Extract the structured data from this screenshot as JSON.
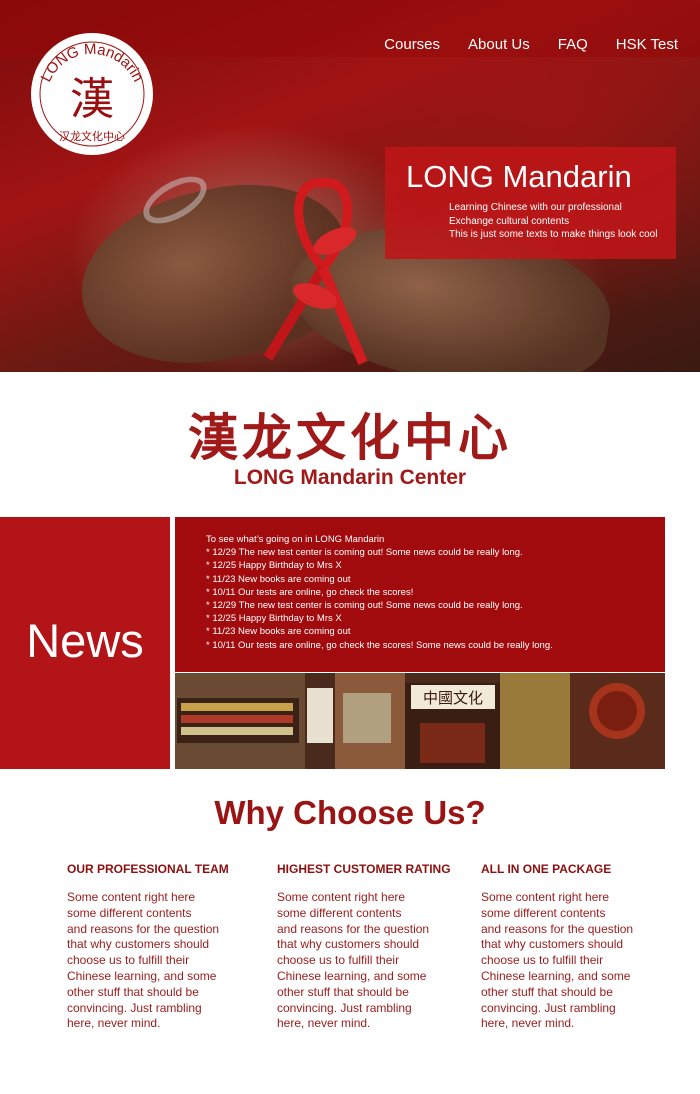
{
  "nav": {
    "items": [
      "Courses",
      "About Us",
      "FAQ",
      "HSK Test"
    ]
  },
  "logo": {
    "text": "LONG Mandarin",
    "chars": "汉龙文化中心",
    "glyph": "漢"
  },
  "hero": {
    "title": "LONG Mandarin",
    "lines": [
      "Learning Chinese with our professional",
      "Exchange cultural contents",
      "This is just some texts to make things look cool"
    ]
  },
  "headings": {
    "chinese": "漢龙文化中心",
    "english": "LONG Mandarin Center"
  },
  "news": {
    "label": "News",
    "items": [
      "To see what’s going on in LONG Mandarin",
      "* 12/29 The new test center is coming out! Some news could be really long.",
      "* 12/25 Happy Birthday to Mrs X",
      "* 11/23 New books are coming out",
      "* 10/11 Our tests are online, go check the scores!",
      "* 12/29 The new test center is coming out! Some news could be really long.",
      "* 12/25 Happy Birthday to Mrs X",
      "* 11/23 New books are coming out",
      "* 10/11 Our tests are online, go check the scores! Some news could be really long."
    ],
    "photo_sign": "中國文化"
  },
  "why": {
    "title": "Why Choose Us?",
    "columns": [
      {
        "heading": "OUR PROFESSIONAL TEAM",
        "lines": [
          "Some content right here",
          "some different contents",
          "and reasons for the question",
          "that why customers should",
          "choose us to fulfill their",
          "Chinese learning, and some",
          "other stuff that should be",
          "convincing. Just rambling",
          "here, never mind."
        ]
      },
      {
        "heading": "HIGHEST CUSTOMER RATING",
        "lines": [
          "Some content right here",
          "some different contents",
          "and reasons for the question",
          "that why customers should",
          "choose us to fulfill their",
          "Chinese learning, and some",
          "other stuff that should be",
          "convincing. Just rambling",
          "here, never mind."
        ]
      },
      {
        "heading": "ALL IN ONE PACKAGE",
        "lines": [
          "Some content right here",
          "some different contents",
          "and reasons for the question",
          "that why customers should",
          "choose us to fulfill their",
          "Chinese learning, and some",
          "other stuff that should be",
          "convincing. Just rambling",
          "here, never mind."
        ]
      }
    ]
  },
  "colors": {
    "brand_red": "#a20b0e",
    "text_red": "#8c1010",
    "white": "#ffffff"
  }
}
